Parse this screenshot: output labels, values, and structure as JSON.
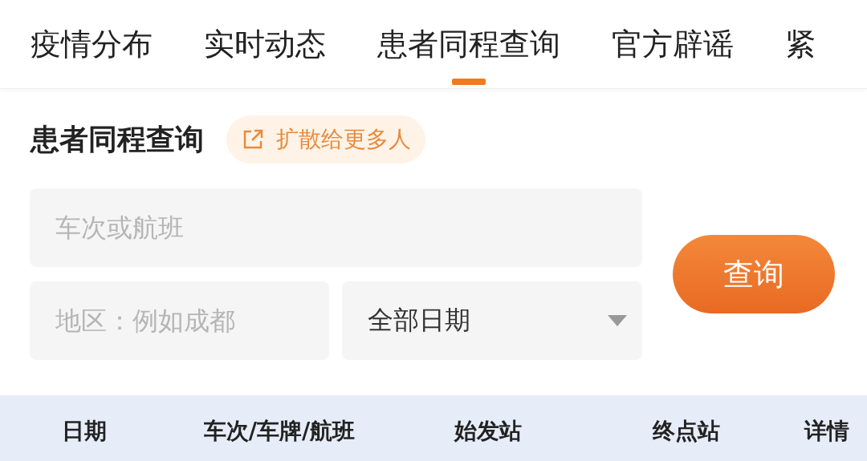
{
  "tabs": [
    {
      "label": "疫情分布",
      "selected": false
    },
    {
      "label": "实时动态",
      "selected": false
    },
    {
      "label": "患者同程查询",
      "selected": true
    },
    {
      "label": "官方辟谣",
      "selected": false
    },
    {
      "label": "紧",
      "selected": false
    }
  ],
  "section": {
    "title": "患者同程查询",
    "share_button": "扩散给更多人"
  },
  "form": {
    "trip_field": {
      "placeholder": "车次或航班"
    },
    "region_field": {
      "placeholder": "地区：例如成都"
    },
    "date_select": {
      "value": "全部日期"
    },
    "search_button": "查询"
  },
  "table": {
    "columns": [
      "日期",
      "车次/车牌/航班",
      "始发站",
      "终点站",
      "详情"
    ]
  }
}
